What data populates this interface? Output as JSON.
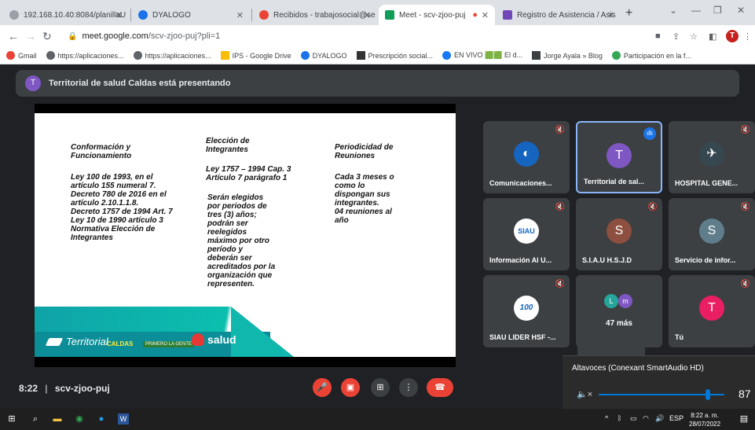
{
  "browser": {
    "tabs": [
      {
        "title": "192.168.10.40:8084/planillaU",
        "color": "#9aa0a6"
      },
      {
        "title": "DYALOGO",
        "color": "#1a73e8"
      },
      {
        "title": "Recibidos - trabajosocial@se",
        "color": "#ea4335"
      },
      {
        "title": "Meet - scv-zjoo-puj",
        "color": "#0f9d58"
      },
      {
        "title": "Registro de Asistencia / Asis",
        "color": "#7248b9"
      }
    ],
    "url_host": "meet.google.com",
    "url_path": "/scv-zjoo-puj?pli=1",
    "profile_initial": "T",
    "bookmarks": [
      {
        "label": "Gmail",
        "icon": "gmail-icon",
        "color": "#ea4335"
      },
      {
        "label": "https://aplicaciones...",
        "icon": "globe-icon",
        "color": "#5f6368"
      },
      {
        "label": "https://aplicaciones...",
        "icon": "globe-icon",
        "color": "#5f6368"
      },
      {
        "label": "IPS - Google Drive",
        "icon": "drive-icon",
        "color": "#fbbc04"
      },
      {
        "label": "DYALOGO",
        "icon": "dyalogo-icon",
        "color": "#1a73e8"
      },
      {
        "label": "Prescripción social...",
        "icon": "prescripcion-icon",
        "color": "#333333"
      },
      {
        "label": "EN VIVO 🟩🟩 El d...",
        "icon": "facebook-icon",
        "color": "#1877f2"
      },
      {
        "label": "Jorge Ayala » Blog",
        "icon": "blog-icon",
        "color": "#3c4043"
      },
      {
        "label": "Participación en la f...",
        "icon": "participacion-icon",
        "color": "#34a853"
      }
    ]
  },
  "meet": {
    "presenter_initial": "T",
    "presenting_text": "Territorial de salud Caldas está presentando",
    "slide": {
      "col1_title": "Conformación y\nFuncionamiento",
      "col1_body": "Ley 100 de 1993, en el\nartículo 155 numeral 7.\nDecreto 780 de 2016 en el\nartículo 2.10.1.1.8.\nDecreto 1757 de 1994 Art. 7\nLey 10 de 1990 artículo 3\nNormativa Elección de\nIntegrantes",
      "col2_title": "Elección de\nIntegrantes",
      "col2_law": "Ley 1757 – 1994 Cap. 3\nArtículo 7 parágrafo 1",
      "col2_body": "Serán elegidos\npor periodos de\ntres (3) años;\npodrán ser\nreelegidos\nmáximo por otro\nperíodo y\ndeberán ser\nacreditados por la\norganización que\nrepresenten.",
      "col3_title": "Periodicidad de\nReuniones",
      "col3_body": "Cada 3 meses o\ncomo lo\ndispongan sus\nintegrantes.\n04 reuniones al\naño",
      "logo_territorial": "Territorial",
      "logo_caldas": "CALDAS",
      "logo_primero": "PRIMERO LA GENTE",
      "logo_salud": "salud"
    },
    "participants": [
      {
        "name": "Comunicaciones...",
        "initial": "",
        "color": "#1565c0"
      },
      {
        "name": "Territorial de sal...",
        "initial": "T",
        "color": "#7e57c2"
      },
      {
        "name": "HOSPITAL GENE...",
        "initial": "",
        "color": "#37474f"
      },
      {
        "name": "Información Al U...",
        "initial": "SIAU",
        "color": "#ffffff"
      },
      {
        "name": "S.I.A.U H.S.J.D",
        "initial": "S",
        "color": "#8d4f3f"
      },
      {
        "name": "Servicio de infor...",
        "initial": "S",
        "color": "#607d8b"
      },
      {
        "name": "SIAU LIDER HSF -...",
        "initial": "100",
        "color": "#ffffff"
      },
      {
        "name": "",
        "initial": "",
        "color": "#3c4043"
      },
      {
        "name": "Tú",
        "initial": "T",
        "color": "#e91e63"
      }
    ],
    "more_count": "47 más",
    "more_initials": [
      "L",
      "m"
    ],
    "time": "8:22",
    "separator": "|",
    "meeting_code": "scv-zjoo-puj"
  },
  "volume": {
    "device": "Altavoces (Conexant SmartAudio HD)",
    "level": 87,
    "level_text": "87"
  },
  "taskbar": {
    "lang": "ESP",
    "time": "8:22 a. m.",
    "date": "28/07/2022"
  }
}
